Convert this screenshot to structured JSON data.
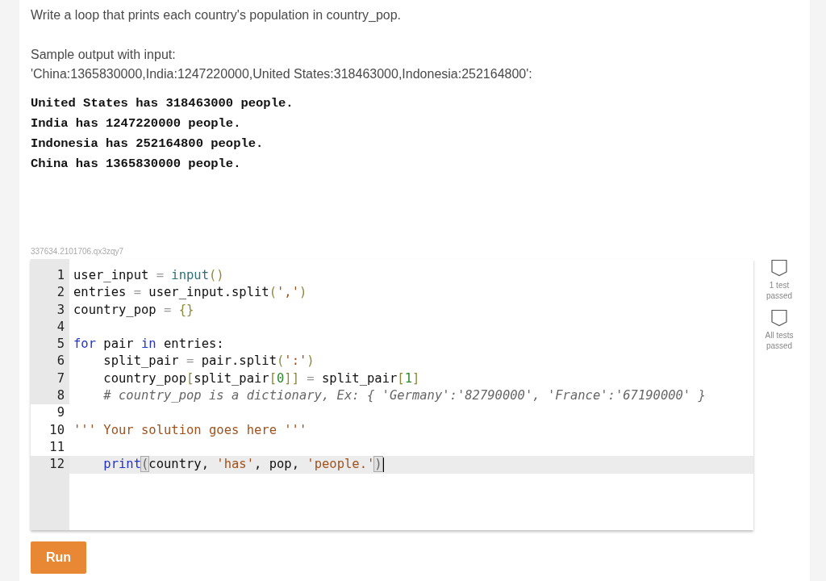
{
  "prompt": "Write a loop that prints each country's population in country_pop.",
  "sample_label": "Sample output with input:",
  "sample_input": "'China:1365830000,India:1247220000,United States:318463000,Indonesia:252164800':",
  "sample_output": [
    "United States has 318463000 people.",
    "India has 1247220000 people.",
    "Indonesia has 252164800 people.",
    "China has 1365830000 people."
  ],
  "challenge_id": "337634.2101706.qx3zqy7",
  "code_lines": [
    {
      "number": "1",
      "readonly": true,
      "active": false,
      "tokens": [
        {
          "kind": "plain",
          "text": "user_input "
        },
        {
          "kind": "op",
          "text": "= "
        },
        {
          "kind": "builtin",
          "text": "input"
        },
        {
          "kind": "bracket",
          "text": "()"
        }
      ]
    },
    {
      "number": "2",
      "readonly": true,
      "active": false,
      "tokens": [
        {
          "kind": "plain",
          "text": "entries "
        },
        {
          "kind": "op",
          "text": "="
        },
        {
          "kind": "plain",
          "text": " user_input.split"
        },
        {
          "kind": "bracket",
          "text": "("
        },
        {
          "kind": "string",
          "text": "','"
        },
        {
          "kind": "bracket",
          "text": ")"
        }
      ]
    },
    {
      "number": "3",
      "readonly": true,
      "active": false,
      "tokens": [
        {
          "kind": "plain",
          "text": "country_pop "
        },
        {
          "kind": "op",
          "text": "= "
        },
        {
          "kind": "bracket",
          "text": "{}"
        }
      ]
    },
    {
      "number": "4",
      "readonly": true,
      "active": false
    },
    {
      "number": "5",
      "readonly": true,
      "active": false,
      "tokens": [
        {
          "kind": "keyword",
          "text": "for"
        },
        {
          "kind": "plain",
          "text": " pair "
        },
        {
          "kind": "keyword",
          "text": "in"
        },
        {
          "kind": "plain",
          "text": " entries:"
        }
      ]
    },
    {
      "number": "6",
      "readonly": true,
      "active": false,
      "tokens": [
        {
          "kind": "plain",
          "text": "    split_pair "
        },
        {
          "kind": "op",
          "text": "="
        },
        {
          "kind": "plain",
          "text": " pair.split"
        },
        {
          "kind": "bracket",
          "text": "("
        },
        {
          "kind": "string",
          "text": "':'"
        },
        {
          "kind": "bracket",
          "text": ")"
        }
      ]
    },
    {
      "number": "7",
      "readonly": true,
      "active": false,
      "tokens": [
        {
          "kind": "plain",
          "text": "    country_pop"
        },
        {
          "kind": "bracket",
          "text": "["
        },
        {
          "kind": "plain",
          "text": "split_pair"
        },
        {
          "kind": "bracket",
          "text": "["
        },
        {
          "kind": "number",
          "text": "0"
        },
        {
          "kind": "bracket",
          "text": "]]"
        },
        {
          "kind": "op",
          "text": " = "
        },
        {
          "kind": "plain",
          "text": "split_pair"
        },
        {
          "kind": "bracket",
          "text": "["
        },
        {
          "kind": "number",
          "text": "1"
        },
        {
          "kind": "bracket",
          "text": "]"
        }
      ]
    },
    {
      "number": "8",
      "readonly": true,
      "active": false,
      "tokens": [
        {
          "kind": "comment",
          "text": "    # country_pop is a dictionary, Ex: { 'Germany':'82790000', 'France':'67190000' }"
        }
      ]
    },
    {
      "number": "9",
      "readonly": false,
      "active": false
    },
    {
      "number": "10",
      "readonly": false,
      "active": false,
      "tokens": [
        {
          "kind": "docstring",
          "text": "''' Your solution goes here '''"
        }
      ]
    },
    {
      "number": "11",
      "readonly": false,
      "active": false
    },
    {
      "number": "12",
      "readonly": false,
      "active": true,
      "tokens": [
        {
          "kind": "keyword",
          "text": "    print"
        },
        {
          "kind": "match",
          "text": "("
        },
        {
          "kind": "plain",
          "text": "country, "
        },
        {
          "kind": "string",
          "text": "'has'"
        },
        {
          "kind": "plain",
          "text": ", pop, "
        },
        {
          "kind": "string",
          "text": "'people.'"
        },
        {
          "kind": "match",
          "text": ")"
        }
      ]
    }
  ],
  "tests": [
    {
      "label": "1 test passed",
      "passed": false
    },
    {
      "label": "All tests passed",
      "passed": false
    }
  ],
  "run_button": "Run"
}
